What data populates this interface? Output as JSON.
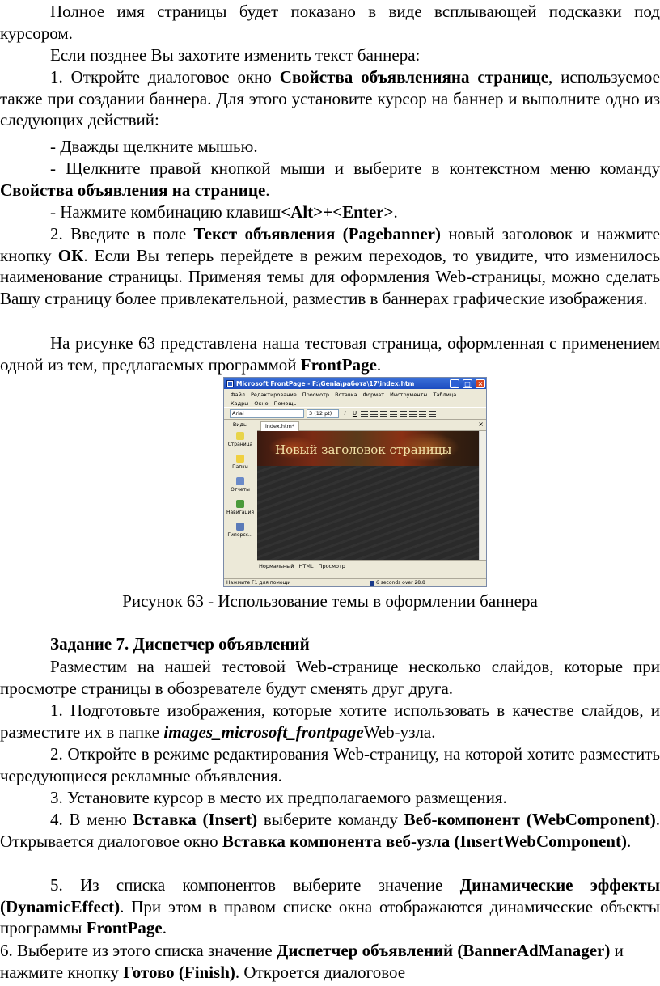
{
  "paragraphs": {
    "p1": "Полное имя страницы будет показано в виде всплывающей подсказки под курсором.",
    "p2": "Если позднее Вы захотите изменить текст баннера:",
    "p3": {
      "a": "1. Откройте диалоговое окно ",
      "b": "Свойства объявленияна странице",
      "c": ", используемое также при создании баннера. Для этого установите курсор на баннер и выполните одно из следующих действий:"
    },
    "p4": "- Дважды щелкните мышью.",
    "p5": {
      "a": "- Щелкните правой кнопкой мыши и выберите в контекстном меню команду ",
      "b": "Свойства объявления на странице",
      "c": "."
    },
    "p6": {
      "a": "- Нажмите комбинацию клавиш",
      "b": "<Alt>",
      "c": "+",
      "d": "<Enter>",
      "e": "."
    },
    "p7": {
      "a": "2. Введите в поле ",
      "b": "Текст объявления (Pagebanner)",
      "c": " новый заголовок и нажмите кнопку ",
      "d": "ОК",
      "e": ". Если Вы теперь перейдете в режим переходов, то увидите, что изменилось наименование страницы. Применяя темы для оформления Web-страницы, можно сделать Вашу страницу более привлекательной, разместив в баннерах графические изображения."
    },
    "p8": {
      "a": "На рисунке 63 представлена наша тестовая страница, оформленная с применением одной из тем, предлагаемых программой ",
      "b": "FrontPage",
      "c": "."
    },
    "caption": "Рисунок 63 - Использование темы в оформлении баннера",
    "heading": "Задание 7. Диспетчер объявлений",
    "p9": "Разместим на нашей тестовой Web-странице несколько слайдов, которые при просмотре страницы в обозревателе будут сменять друг друга.",
    "p10": {
      "a": "1. Подготовьте изображения, которые хотите использовать в качестве слайдов, и разместите их в папке ",
      "b": "images_microsoft_frontpage",
      "c": "Web-узла."
    },
    "p11": "2. Откройте в режиме редактирования Web-страницу, на которой хотите разместить чередующиеся рекламные объявления.",
    "p12": "3. Установите курсор в место их предполагаемого размещения.",
    "p13": {
      "a": "4. В меню ",
      "b": "Вставка (Insert)",
      "c": " выберите команду ",
      "d": "Веб-компонент (WebComponent)",
      "e": ". Открывается диалоговое окно ",
      "f": "Вставка компонента веб-узла (InsertWebComponent)",
      "g": "."
    },
    "p14": {
      "a": "5. Из списка компонентов выберите значение ",
      "b": "Динамические эффекты (DynamicEffect)",
      "c": ". При этом в правом списке окна отображаются динамические объекты программы ",
      "d": "FrontPage",
      "e": "."
    },
    "p15": {
      "a": "6. Выберите из этого списка значение ",
      "b": "Диспетчер объявлений (BannerAdManager)",
      "c": " и нажмите кнопку ",
      "d": "Готово (Finish)",
      "e": ". Откроется диалоговое"
    }
  },
  "screenshot": {
    "title": "Microsoft FrontPage - F:\\Genia\\работа\\17\\index.htm",
    "menu": [
      "Файл",
      "Редактирование",
      "Просмотр",
      "Вставка",
      "Формат",
      "Инструменты",
      "Таблица",
      "Кадры",
      "Окно",
      "Помощь"
    ],
    "font_combo": "Arial",
    "size_combo": "3  (12 pt)",
    "fmt_buttons": [
      "I",
      "U"
    ],
    "views_header": "Виды",
    "views": [
      {
        "label": "Страница",
        "icon": "page-icon",
        "color": "#e8d44a"
      },
      {
        "label": "Папки",
        "icon": "folder-icon",
        "color": "#f0d040"
      },
      {
        "label": "Отчеты",
        "icon": "reports-icon",
        "color": "#6a8ac8"
      },
      {
        "label": "Навигация",
        "icon": "navigation-icon",
        "color": "#4a9a3a"
      },
      {
        "label": "Гиперсс...",
        "icon": "hyperlinks-icon",
        "color": "#5a7ab8"
      }
    ],
    "tab": "index.htm*",
    "banner_text": "Новый заголовок страницы",
    "modes": [
      "Нормальный",
      "HTML",
      "Просмотр"
    ],
    "status_left": "Нажмите F1 для помощи",
    "status_right": "6 seconds over 28.8"
  }
}
